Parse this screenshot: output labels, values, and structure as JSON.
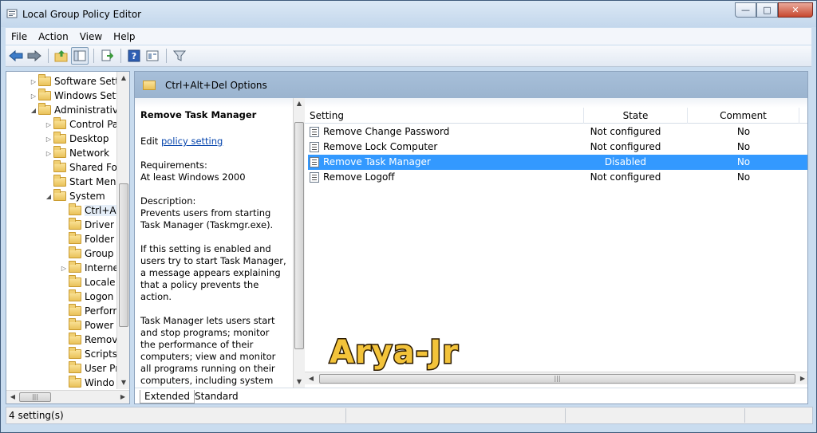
{
  "window": {
    "title": "Local Group Policy Editor",
    "buttons": {
      "minimize": "—",
      "maximize": "□",
      "close": "✕"
    }
  },
  "menu": [
    "File",
    "Action",
    "View",
    "Help"
  ],
  "toolbar": {
    "icons": [
      "back-icon",
      "forward-icon",
      "up-folder-icon",
      "show-hide-tree-icon",
      "export-list-icon",
      "help-icon",
      "properties-icon",
      "filter-icon"
    ]
  },
  "tree": {
    "items": [
      {
        "label": "Software Setti",
        "arrow": "▷"
      },
      {
        "label": "Windows Sett",
        "arrow": "▷"
      },
      {
        "label": "Administrativ",
        "arrow": "◢"
      },
      {
        "label": "Control Pa",
        "arrow": "▷"
      },
      {
        "label": "Desktop",
        "arrow": "▷"
      },
      {
        "label": "Network",
        "arrow": "▷"
      },
      {
        "label": "Shared Fol",
        "arrow": ""
      },
      {
        "label": "Start Menu",
        "arrow": ""
      },
      {
        "label": "System",
        "arrow": "◢"
      },
      {
        "label": "Ctrl+A",
        "arrow": ""
      },
      {
        "label": "Driver I",
        "arrow": ""
      },
      {
        "label": "Folder",
        "arrow": ""
      },
      {
        "label": "Group",
        "arrow": ""
      },
      {
        "label": "Interne",
        "arrow": "▷"
      },
      {
        "label": "Locale",
        "arrow": ""
      },
      {
        "label": "Logon",
        "arrow": ""
      },
      {
        "label": "Perforn",
        "arrow": ""
      },
      {
        "label": "Power",
        "arrow": ""
      },
      {
        "label": "Remov",
        "arrow": ""
      },
      {
        "label": "Scripts",
        "arrow": ""
      },
      {
        "label": "User Pr",
        "arrow": ""
      },
      {
        "label": "Windo",
        "arrow": ""
      }
    ]
  },
  "content": {
    "header": "Ctrl+Alt+Del Options",
    "description": {
      "title": "Remove Task Manager",
      "edit_prefix": "Edit ",
      "edit_link": "policy setting",
      "requirements_label": "Requirements:",
      "requirements_value": "At least Windows 2000",
      "description_label": "Description:",
      "description_text": "Prevents users from starting Task Manager (Taskmgr.exe).",
      "paragraph2": "If this setting is enabled and users try to start Task Manager, a message appears explaining that a policy prevents the action.",
      "paragraph3": "Task Manager lets users start and stop programs; monitor the performance of their computers; view and monitor all programs running on their computers, including system services; find the executable names of programs;"
    },
    "columns": {
      "setting": "Setting",
      "state": "State",
      "comment": "Comment"
    },
    "rows": [
      {
        "setting": "Remove Change Password",
        "state": "Not configured",
        "comment": "No",
        "selected": false
      },
      {
        "setting": "Remove Lock Computer",
        "state": "Not configured",
        "comment": "No",
        "selected": false
      },
      {
        "setting": "Remove Task Manager",
        "state": "Disabled",
        "comment": "No",
        "selected": true
      },
      {
        "setting": "Remove Logoff",
        "state": "Not configured",
        "comment": "No",
        "selected": false
      }
    ],
    "tabs": {
      "extended": "Extended",
      "standard": "Standard"
    }
  },
  "status": {
    "text": "4 setting(s)"
  },
  "watermark": "Arya-Jr",
  "colors": {
    "selection": "#3399ff",
    "header_bg": "#a7bfd9",
    "link": "#0645ad"
  }
}
